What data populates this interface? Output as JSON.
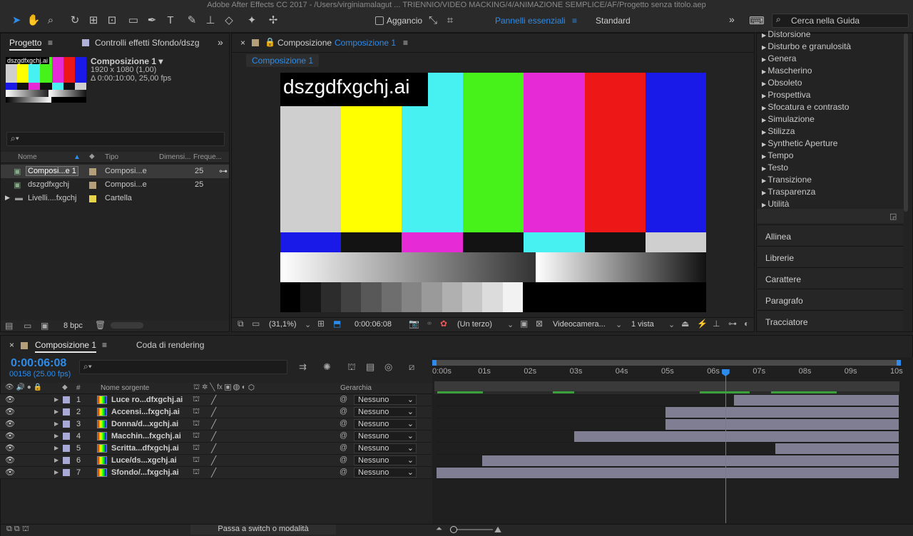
{
  "window_title": "Adobe After Effects CC 2017 - /Users/virginiamalagut ... TRIENNIO/VIDEO MACKING/4/ANIMAZIONE SEMPLICE/AF/Progetto senza titolo.aep",
  "toolbar": {
    "snap_label": "Aggancio",
    "workspace_active": "Pannelli essenziali",
    "workspace_other": "Standard",
    "search_placeholder": "Cerca nella Guida"
  },
  "project_panel": {
    "tab_project": "Progetto",
    "tab_effects": "Controlli effetti Sfondo/dszg",
    "thumb_label": "dszgdfxgchj.ai",
    "comp_name": "Composizione 1 ▾",
    "comp_size": "1920 x 1080 (1,00)",
    "comp_duration": "Δ 0:00:10:00, 25,00 fps",
    "columns": [
      "Nome",
      "Tipo",
      "Dimensi...",
      "Freque..."
    ],
    "items": [
      {
        "name": "Composi...e 1",
        "type": "Composi...e",
        "fps": "25",
        "swatch": "#b3a07a"
      },
      {
        "name": "dszgdfxgchj",
        "type": "Composi...e",
        "fps": "25",
        "swatch": "#b3a07a"
      },
      {
        "name": "Livelli....fxgchj",
        "type": "Cartella",
        "fps": "",
        "swatch": "#e8d44a"
      }
    ],
    "bpc": "8 bpc"
  },
  "composition_panel": {
    "title_prefix": "Composizione",
    "title_name": "Composizione 1",
    "subtab": "Composizione 1",
    "overlay_text": "dszgdfxgchj.ai",
    "zoom": "(31,1%)",
    "timecode": "0:00:06:08",
    "resolution": "(Un terzo)",
    "camera": "Videocamera...",
    "views": "1 vista"
  },
  "effects_list": [
    "Distorsione",
    "Disturbo e granulosità",
    "Genera",
    "Mascherino",
    "Obsoleto",
    "Prospettiva",
    "Sfocatura e contrasto",
    "Simulazione",
    "Stilizza",
    "Synthetic Aperture",
    "Tempo",
    "Testo",
    "Transizione",
    "Trasparenza",
    "Utilità"
  ],
  "side_panels": [
    "Allinea",
    "Librerie",
    "Carattere",
    "Paragrafo",
    "Tracciatore"
  ],
  "timeline": {
    "tab_comp": "Composizione 1",
    "tab_render": "Coda di rendering",
    "timecode": "0:00:06:08",
    "frame_info": "00158 (25.00 fps)",
    "col_source": "Nome sorgente",
    "col_parent": "Gerarchia",
    "col_hash": "#",
    "ruler": [
      "0:00s",
      "01s",
      "02s",
      "03s",
      "04s",
      "05s",
      "06s",
      "07s",
      "08s",
      "09s",
      "10s"
    ],
    "current_time_s": 6.32,
    "duration_s": 10,
    "layers": [
      {
        "num": "1",
        "name": "Luce ro...dfxgchj.ai",
        "parent": "Nessuno",
        "in_s": 6.5,
        "out_s": 10
      },
      {
        "num": "2",
        "name": "Accensi...fxgchj.ai",
        "parent": "Nessuno",
        "in_s": 5.0,
        "out_s": 10
      },
      {
        "num": "3",
        "name": "Donna/d...xgchj.ai",
        "parent": "Nessuno",
        "in_s": 5.0,
        "out_s": 10
      },
      {
        "num": "4",
        "name": "Macchin...fxgchj.ai",
        "parent": "Nessuno",
        "in_s": 3.0,
        "out_s": 10
      },
      {
        "num": "5",
        "name": "Scritta...dfxgchj.ai",
        "parent": "Nessuno",
        "in_s": 7.4,
        "out_s": 10
      },
      {
        "num": "6",
        "name": "Luce/ds...xgchj.ai",
        "parent": "Nessuno",
        "in_s": 1.0,
        "out_s": 10
      },
      {
        "num": "7",
        "name": "Sfondo/...fxgchj.ai",
        "parent": "Nessuno",
        "in_s": 0.0,
        "out_s": 10
      }
    ],
    "footer_toggle": "Passa a switch o modalità"
  },
  "colors": {
    "accent": "#2d8ceb",
    "layer_label": "#a9a9d8",
    "layer_bar": "#7f7e92"
  }
}
